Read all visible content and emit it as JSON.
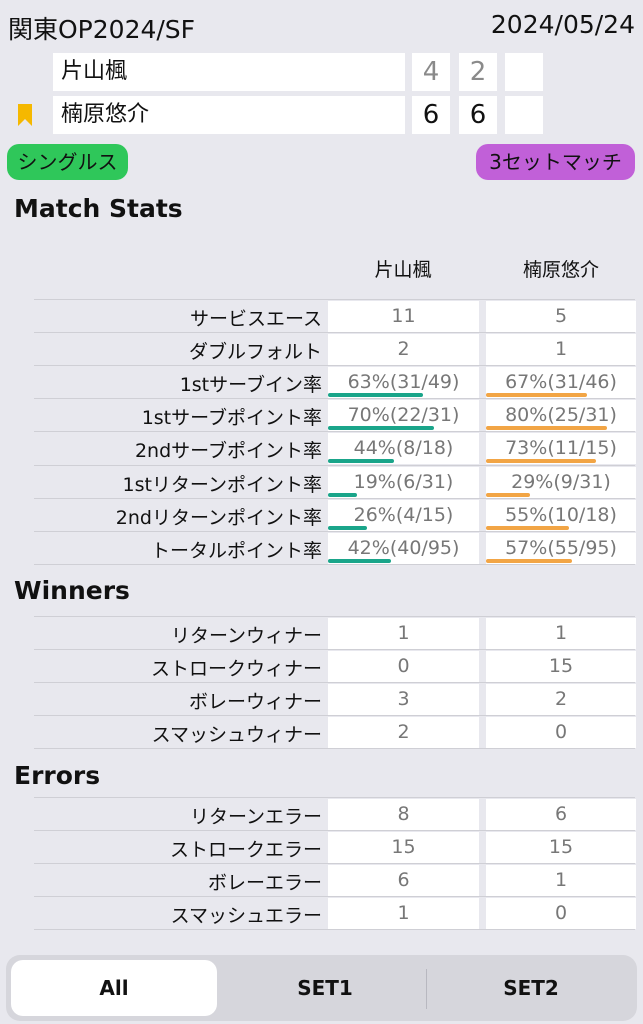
{
  "header": {
    "title": "関東OP2024/SF",
    "date": "2024/05/24"
  },
  "players": [
    {
      "name": "片山楓",
      "sets": [
        "4",
        "2",
        ""
      ],
      "bookmark": false
    },
    {
      "name": "楠原悠介",
      "sets": [
        "6",
        "6",
        ""
      ],
      "bookmark": true
    }
  ],
  "pills": {
    "type": "シングルス",
    "format": "3セットマッチ"
  },
  "colors": {
    "green": "#2fc75a",
    "purple": "#c160d8",
    "player1_bar": "#1aa58a",
    "player2_bar": "#f2a545",
    "bookmark": "#f5b800"
  },
  "columns": {
    "p1": "片山楓",
    "p2": "楠原悠介"
  },
  "sections": {
    "match_stats": {
      "title": "Match Stats",
      "rows": [
        {
          "label": "サービスエース",
          "p1": "11",
          "p2": "5"
        },
        {
          "label": "ダブルフォルト",
          "p1": "2",
          "p2": "1"
        },
        {
          "label": "1stサーブイン率",
          "p1": "63%(31/49)",
          "p2": "67%(31/46)",
          "p1_pct": 63,
          "p2_pct": 67
        },
        {
          "label": "1stサーブポイント率",
          "p1": "70%(22/31)",
          "p2": "80%(25/31)",
          "p1_pct": 70,
          "p2_pct": 80
        },
        {
          "label": "2ndサーブポイント率",
          "p1": "44%(8/18)",
          "p2": "73%(11/15)",
          "p1_pct": 44,
          "p2_pct": 73
        },
        {
          "label": "1stリターンポイント率",
          "p1": "19%(6/31)",
          "p2": "29%(9/31)",
          "p1_pct": 19,
          "p2_pct": 29
        },
        {
          "label": "2ndリターンポイント率",
          "p1": "26%(4/15)",
          "p2": "55%(10/18)",
          "p1_pct": 26,
          "p2_pct": 55
        },
        {
          "label": "トータルポイント率",
          "p1": "42%(40/95)",
          "p2": "57%(55/95)",
          "p1_pct": 42,
          "p2_pct": 57
        }
      ]
    },
    "winners": {
      "title": "Winners",
      "rows": [
        {
          "label": "リターンウィナー",
          "p1": "1",
          "p2": "1"
        },
        {
          "label": "ストロークウィナー",
          "p1": "0",
          "p2": "15"
        },
        {
          "label": "ボレーウィナー",
          "p1": "3",
          "p2": "2"
        },
        {
          "label": "スマッシュウィナー",
          "p1": "2",
          "p2": "0"
        }
      ]
    },
    "errors": {
      "title": "Errors",
      "rows": [
        {
          "label": "リターンエラー",
          "p1": "8",
          "p2": "6"
        },
        {
          "label": "ストロークエラー",
          "p1": "15",
          "p2": "15"
        },
        {
          "label": "ボレーエラー",
          "p1": "6",
          "p2": "1"
        },
        {
          "label": "スマッシュエラー",
          "p1": "1",
          "p2": "0"
        }
      ]
    }
  },
  "tabs": [
    {
      "label": "All",
      "active": true
    },
    {
      "label": "SET1",
      "active": false
    },
    {
      "label": "SET2",
      "active": false
    }
  ]
}
